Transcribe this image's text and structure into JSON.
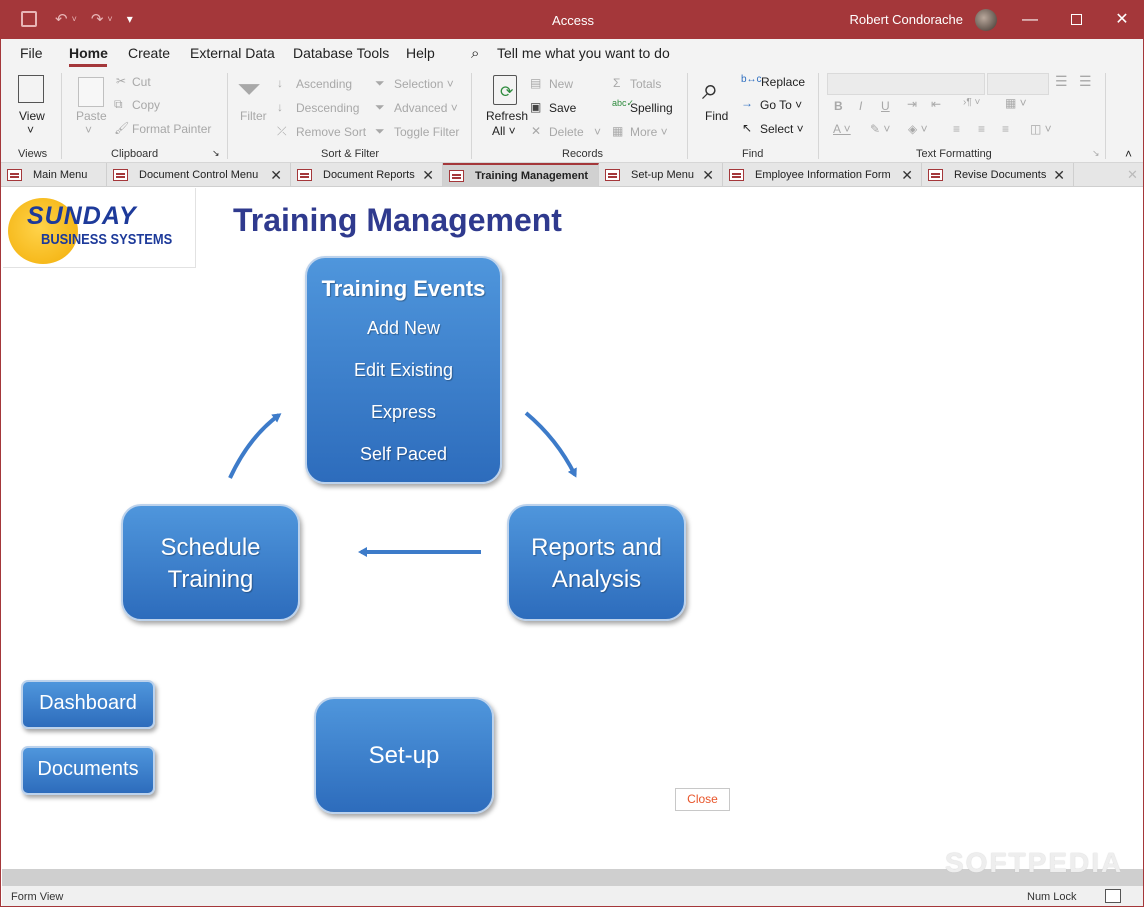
{
  "app": {
    "title": "Access",
    "user": "Robert Condorache"
  },
  "qat": {
    "save": "save-icon",
    "undo": "undo-icon",
    "redo": "redo-icon",
    "customize": "▾"
  },
  "menu": [
    "File",
    "Home",
    "Create",
    "External Data",
    "Database Tools",
    "Help"
  ],
  "search": {
    "placeholder": "Tell me what you want to do"
  },
  "ribbon": {
    "views": {
      "view": "View",
      "group": "Views"
    },
    "clipboard": {
      "paste": "Paste",
      "cut": "Cut",
      "copy": "Copy",
      "format_painter": "Format Painter",
      "group": "Clipboard"
    },
    "sort_filter": {
      "filter": "Filter",
      "ascending": "Ascending",
      "descending": "Descending",
      "remove_sort": "Remove Sort",
      "selection": "Selection ˅",
      "advanced": "Advanced ˅",
      "toggle_filter": "Toggle Filter",
      "group": "Sort & Filter"
    },
    "records": {
      "refresh": "Refresh",
      "refresh_all": "All ˅",
      "new": "New",
      "save": "Save",
      "delete": "Delete",
      "totals": "Totals",
      "spelling": "Spelling",
      "more": "More ˅",
      "group": "Records"
    },
    "find": {
      "find": "Find",
      "replace": "Replace",
      "goto": "Go To ˅",
      "select": "Select ˅",
      "group": "Find"
    },
    "text_formatting": {
      "bold": "B",
      "italic": "I",
      "underline": "U",
      "group": "Text Formatting"
    }
  },
  "tabs": [
    {
      "label": "Main Menu",
      "closable": false
    },
    {
      "label": "Document Control Menu",
      "closable": true
    },
    {
      "label": "Document Reports",
      "closable": true
    },
    {
      "label": "Training Management",
      "closable": false,
      "active": true
    },
    {
      "label": "Set-up Menu",
      "closable": true
    },
    {
      "label": "Employee Information Form",
      "closable": true
    },
    {
      "label": "Revise Documents",
      "closable": true
    }
  ],
  "form": {
    "logo_line1": "SUNDAY",
    "logo_line2": "BUSINESS SYSTEMS",
    "title": "Training Management",
    "training_events": {
      "heading": "Training Events",
      "items": [
        "Add New",
        "Edit Existing",
        "Express",
        "Self Paced"
      ]
    },
    "schedule": [
      "Schedule",
      "Training"
    ],
    "reports": [
      "Reports and",
      "Analysis"
    ],
    "setup": "Set-up",
    "dashboard": "Dashboard",
    "documents": "Documents",
    "close": "Close"
  },
  "colors": {
    "accent": "#a4373a",
    "button_blue": "#3a7ccb",
    "title_blue": "#2f3a8e",
    "close_text": "#e8552a"
  },
  "status": {
    "view": "Form View",
    "numlock": "Num Lock"
  },
  "watermark": "SOFTPEDIA"
}
